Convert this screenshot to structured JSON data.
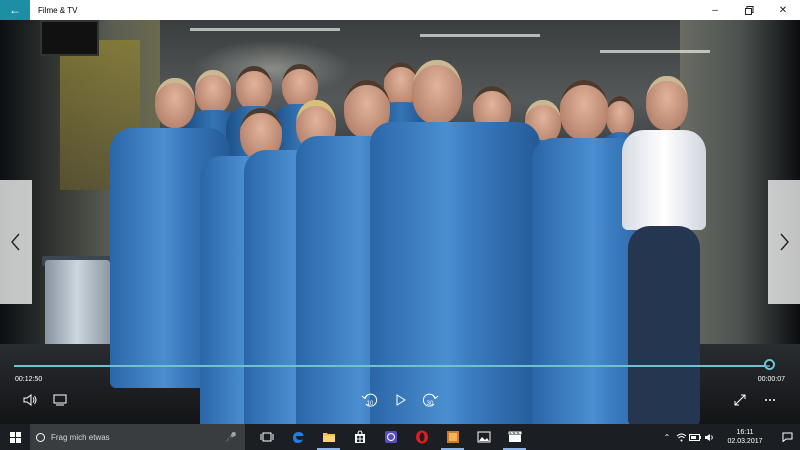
{
  "window": {
    "title": "Filme & TV",
    "back_icon": "back-arrow-icon",
    "minimize_icon": "minimize-icon",
    "maximize_icon": "restore-icon",
    "close_icon": "close-icon"
  },
  "player": {
    "elapsed": "00:12:50",
    "remaining": "00:00:07",
    "progress": 0.99,
    "accent": "#6fc1d0",
    "controls": [
      "volume-icon",
      "subtitles-icon",
      "skip-back-10-icon",
      "play-icon",
      "skip-forward-30-icon",
      "fullscreen-icon",
      "more-icon"
    ],
    "skip_back_label": "10",
    "skip_forward_label": "30"
  },
  "taskbar": {
    "search_placeholder": "Frag mich etwas",
    "apps": [
      "task-view-icon",
      "edge-icon",
      "file-explorer-icon",
      "store-icon",
      "app-7-icon",
      "opera-icon",
      "photos-app-icon",
      "photos-icon",
      "movies-tv-icon"
    ],
    "time": "16:11",
    "date": "02.03.2017",
    "bg": "#1b1f23"
  }
}
